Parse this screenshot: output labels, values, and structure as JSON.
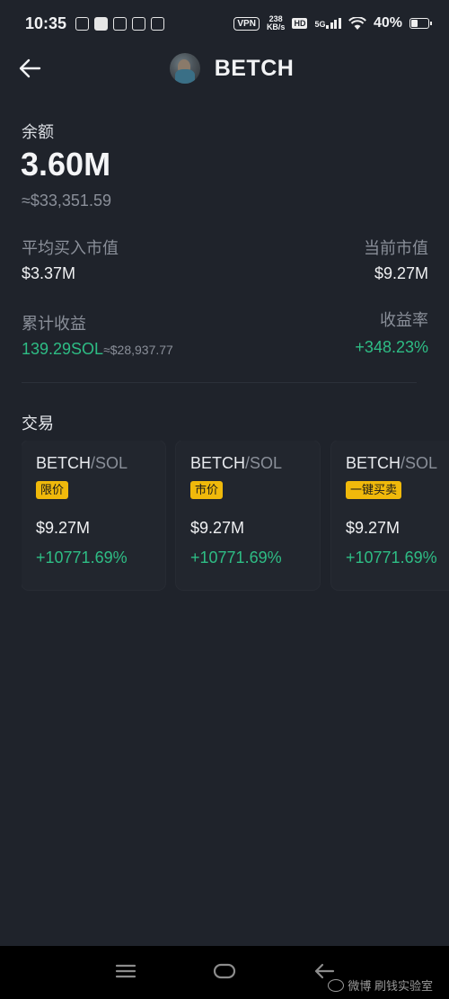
{
  "status_bar": {
    "time": "10:35",
    "vpn": "VPN",
    "speed_value": "238",
    "speed_unit": "KB/s",
    "hd": "HD",
    "network": "5G",
    "battery": "40%",
    "battery_level": 0.4
  },
  "header": {
    "title": "BETCH"
  },
  "balance": {
    "label": "余额",
    "value": "3.60M",
    "usd": "≈$33,351.59"
  },
  "stats": {
    "avg_buy_label": "平均买入市值",
    "avg_buy_value": "$3.37M",
    "current_label": "当前市值",
    "current_value": "$9.27M",
    "cumulative_label": "累计收益",
    "cumulative_sol": "139.29SOL",
    "cumulative_usd": "≈$28,937.77",
    "yield_label": "收益率",
    "yield_value": "+348.23%"
  },
  "trade": {
    "title": "交易",
    "cards": [
      {
        "base": "BETCH",
        "quote": "/SOL",
        "tag": "限价",
        "price": "$9.27M",
        "change": "+10771.69%"
      },
      {
        "base": "BETCH",
        "quote": "/SOL",
        "tag": "市价",
        "price": "$9.27M",
        "change": "+10771.69%"
      },
      {
        "base": "BETCH",
        "quote": "/SOL",
        "tag": "一键买卖",
        "price": "$9.27M",
        "change": "+10771.69%"
      }
    ]
  },
  "watermark": "微博 刷钱实验室",
  "colors": {
    "background": "#1f232b",
    "positive": "#2ebd85",
    "tag": "#f0b90b"
  }
}
